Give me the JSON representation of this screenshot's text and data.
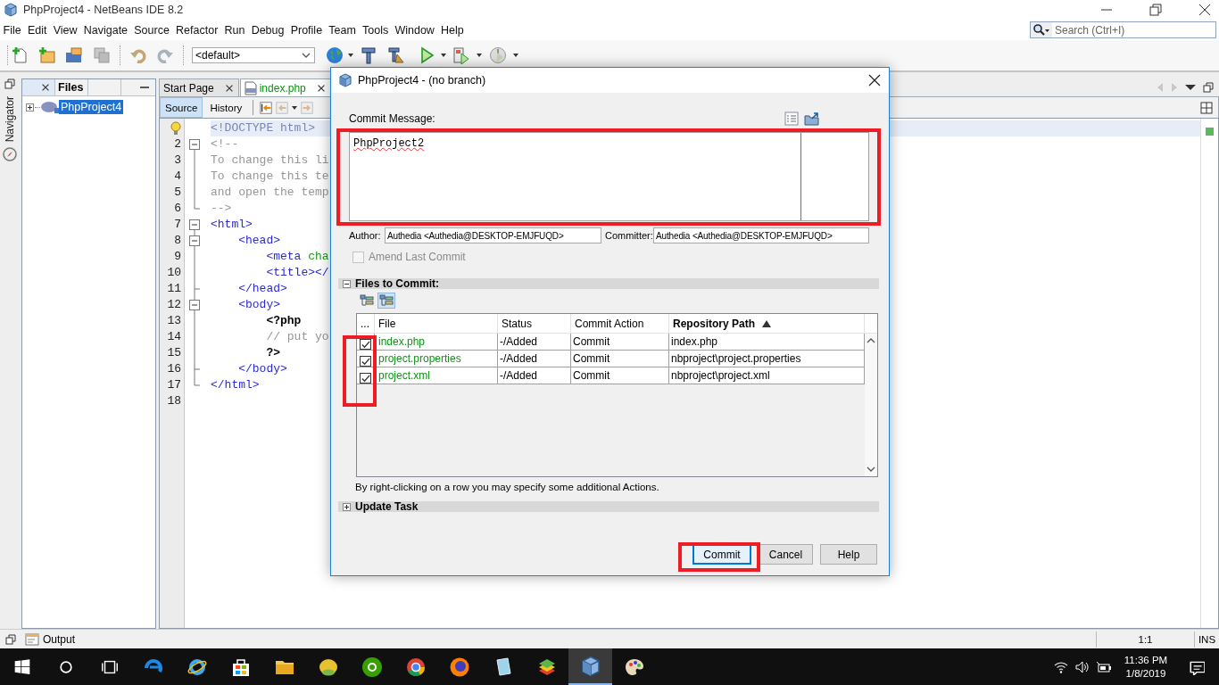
{
  "window": {
    "title": "PhpProject4 - NetBeans IDE 8.2"
  },
  "menu": [
    "File",
    "Edit",
    "View",
    "Navigate",
    "Source",
    "Refactor",
    "Run",
    "Debug",
    "Profile",
    "Team",
    "Tools",
    "Window",
    "Help"
  ],
  "search": {
    "placeholder": "Search (Ctrl+I)"
  },
  "toolbar": {
    "configuration": "<default>"
  },
  "side_strip": {
    "label": "Navigator"
  },
  "files_panel": {
    "title": "Files",
    "tree": [
      {
        "label": "PhpProject4",
        "selected": true,
        "expanded": false
      }
    ]
  },
  "editor": {
    "tabs": [
      {
        "label": "Start Page",
        "selected": false
      },
      {
        "label": "index.php",
        "selected": true
      }
    ],
    "views": [
      {
        "label": "Source",
        "selected": true
      },
      {
        "label": "History",
        "selected": false
      }
    ],
    "lines": [
      {
        "hint": true,
        "current": true,
        "fold_open": false,
        "fold_close": false,
        "segments": [
          {
            "kind": "doctype",
            "text": "<!DOCTYPE html>"
          }
        ]
      },
      {
        "number": "2",
        "hint": false,
        "current": false,
        "fold_open": true,
        "fold_close": false,
        "segments": [
          {
            "kind": "comment",
            "text": "<!--"
          }
        ]
      },
      {
        "number": "3",
        "hint": false,
        "current": false,
        "fold_open": false,
        "fold_close": false,
        "segments": [
          {
            "kind": "comment",
            "text": "To change this li"
          }
        ]
      },
      {
        "number": "4",
        "hint": false,
        "current": false,
        "fold_open": false,
        "fold_close": false,
        "segments": [
          {
            "kind": "comment",
            "text": "To change this te"
          }
        ]
      },
      {
        "number": "5",
        "hint": false,
        "current": false,
        "fold_open": false,
        "fold_close": false,
        "segments": [
          {
            "kind": "comment",
            "text": "and open the temp"
          }
        ]
      },
      {
        "number": "6",
        "hint": false,
        "current": false,
        "fold_open": false,
        "fold_close": true,
        "segments": [
          {
            "kind": "comment",
            "text": "-->"
          }
        ]
      },
      {
        "number": "7",
        "hint": false,
        "current": false,
        "fold_open": true,
        "fold_close": false,
        "segments": [
          {
            "kind": "tag",
            "text": "<html>"
          }
        ]
      },
      {
        "number": "8",
        "hint": false,
        "current": false,
        "fold_open": true,
        "fold_close": false,
        "segments": [
          {
            "kind": "tag",
            "text": "    <head>"
          }
        ]
      },
      {
        "number": "9",
        "hint": false,
        "current": false,
        "fold_open": false,
        "fold_close": false,
        "segments": [
          {
            "kind": "tag",
            "text": "        <meta"
          },
          {
            "kind": "attr",
            "text": " cha"
          }
        ]
      },
      {
        "number": "10",
        "hint": false,
        "current": false,
        "fold_open": false,
        "fold_close": false,
        "segments": [
          {
            "kind": "tag",
            "text": "        <title></"
          }
        ]
      },
      {
        "number": "11",
        "hint": false,
        "current": false,
        "fold_open": false,
        "fold_close": true,
        "segments": [
          {
            "kind": "tag",
            "text": "    </head>"
          }
        ]
      },
      {
        "number": "12",
        "hint": false,
        "current": false,
        "fold_open": true,
        "fold_close": false,
        "segments": [
          {
            "kind": "tag",
            "text": "    <body>"
          }
        ]
      },
      {
        "number": "13",
        "hint": false,
        "current": false,
        "fold_open": false,
        "fold_close": false,
        "segments": [
          {
            "kind": "php",
            "text": "        <?php"
          }
        ]
      },
      {
        "number": "14",
        "hint": false,
        "current": false,
        "fold_open": false,
        "fold_close": false,
        "segments": [
          {
            "kind": "comment",
            "text": "        // put yo"
          }
        ]
      },
      {
        "number": "15",
        "hint": false,
        "current": false,
        "fold_open": false,
        "fold_close": false,
        "segments": [
          {
            "kind": "php",
            "text": "        ?>"
          }
        ]
      },
      {
        "number": "16",
        "hint": false,
        "current": false,
        "fold_open": false,
        "fold_close": true,
        "segments": [
          {
            "kind": "tag",
            "text": "    </body>"
          }
        ]
      },
      {
        "number": "17",
        "hint": false,
        "current": false,
        "fold_open": false,
        "fold_close": true,
        "segments": [
          {
            "kind": "tag",
            "text": "</html>"
          }
        ]
      },
      {
        "number": "18",
        "hint": false,
        "current": false,
        "fold_open": false,
        "fold_close": false
      }
    ]
  },
  "dialog": {
    "title": "PhpProject4 - (no branch)",
    "message_label": "Commit Message:",
    "message": "PhpProject2",
    "highlight_message": true,
    "author_label": "Author:",
    "author": "Authedia <Authedia@DESKTOP-EMJFUQD>",
    "committer_label": "Committer:",
    "committer": "Authedia <Authedia@DESKTOP-EMJFUQD>",
    "amend": {
      "label": "Amend Last Commit",
      "checked": false,
      "disabled": true
    },
    "files_section": {
      "title": "Files to Commit:",
      "expanded": true
    },
    "view_toggles": [
      {
        "selected": false
      },
      {
        "selected": true
      }
    ],
    "table": {
      "highlight_checkboxes": true,
      "columns": [
        {
          "label": "...",
          "sorted": false
        },
        {
          "label": "File",
          "sorted": false
        },
        {
          "label": "Status",
          "sorted": false
        },
        {
          "label": "Commit Action",
          "sorted": false
        },
        {
          "label": "Repository Path",
          "sorted": true
        }
      ],
      "rows": [
        {
          "checked": true,
          "file": "index.php",
          "status": "-/Added",
          "action": "Commit",
          "path": "index.php"
        },
        {
          "checked": true,
          "file": "project.properties",
          "status": "-/Added",
          "action": "Commit",
          "path": "nbproject\\project.properties"
        },
        {
          "checked": true,
          "file": "project.xml",
          "status": "-/Added",
          "action": "Commit",
          "path": "nbproject\\project.xml"
        }
      ]
    },
    "hint": "By right-clicking on a row you may specify some additional Actions.",
    "update_section": {
      "title": "Update Task",
      "expanded": false
    },
    "buttons": [
      {
        "label": "Commit",
        "default": true,
        "highlighted": true
      },
      {
        "label": "Cancel",
        "default": false,
        "highlighted": false
      },
      {
        "label": "Help",
        "default": false,
        "highlighted": false
      }
    ]
  },
  "status_bar": {
    "panel": "Output",
    "position": "1:1",
    "mode": "INS"
  },
  "taskbar": {
    "apps": [
      {
        "kind": "start",
        "selected": false
      },
      {
        "kind": "search",
        "selected": false
      },
      {
        "kind": "taskview",
        "selected": false
      },
      {
        "kind": "swirl",
        "selected": false
      },
      {
        "kind": "ring",
        "selected": false
      },
      {
        "kind": "bag",
        "selected": false
      },
      {
        "kind": "folder",
        "selected": false
      },
      {
        "kind": "blob",
        "selected": false
      },
      {
        "kind": "disc",
        "selected": false
      },
      {
        "kind": "wheel",
        "selected": false
      },
      {
        "kind": "flame",
        "selected": false
      },
      {
        "kind": "notepad",
        "selected": false
      },
      {
        "kind": "layers",
        "selected": false
      },
      {
        "kind": "cube",
        "selected": true
      },
      {
        "kind": "palette",
        "selected": false
      }
    ],
    "clock": {
      "time": "11:36 PM",
      "date": "1/8/2019"
    }
  }
}
